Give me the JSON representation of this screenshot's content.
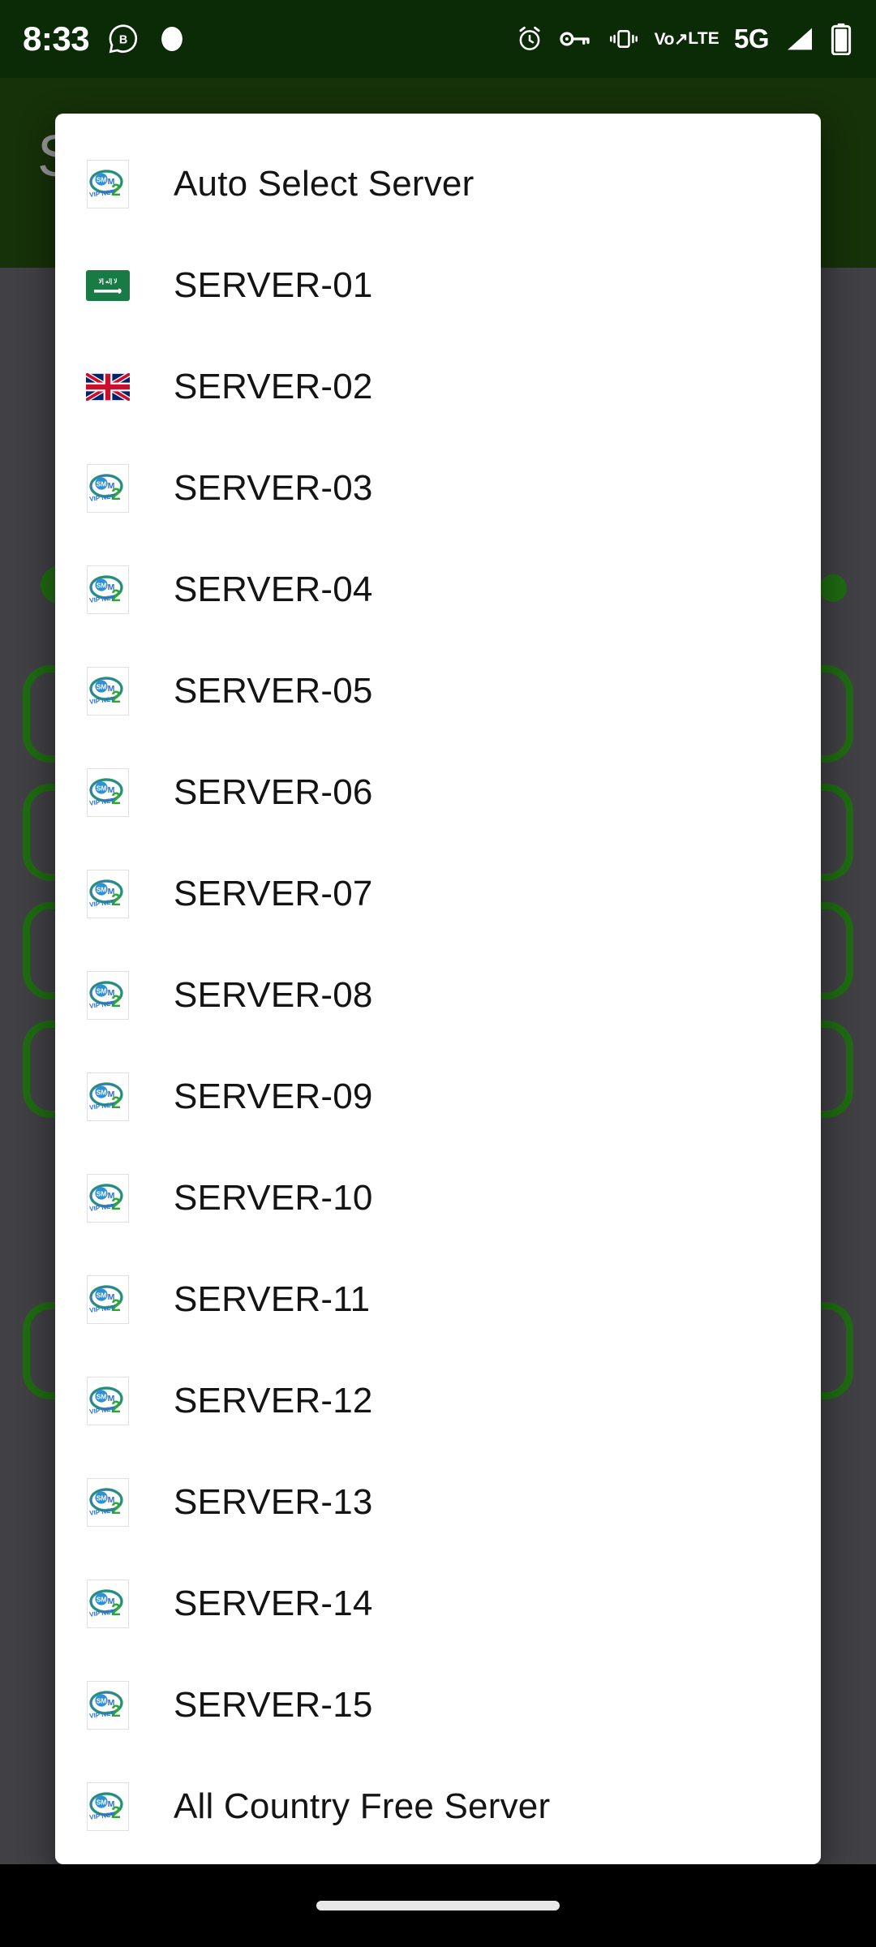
{
  "statusbar": {
    "clock": "8:33",
    "left_icons": [
      {
        "name": "whatsapp-business-icon",
        "glyph": "B"
      },
      {
        "name": "notification-dot-icon",
        "glyph": "●"
      }
    ],
    "right_icons": [
      {
        "name": "alarm-icon",
        "label": "alarm"
      },
      {
        "name": "vpn-key-icon",
        "label": "vpn key"
      },
      {
        "name": "vibrate-icon",
        "label": "vibrate"
      },
      {
        "name": "volte-icon",
        "line1": "Vo",
        "line2": "LTE"
      },
      {
        "name": "network-5g-icon",
        "label": "5G"
      },
      {
        "name": "signal-bars-icon",
        "label": "signal"
      },
      {
        "name": "battery-icon",
        "label": "battery"
      }
    ]
  },
  "background": {
    "appbar_title": "S",
    "accent_green": "#1f6b12",
    "appbar_color": "#163209",
    "scrim_color": "rgba(30,30,34,0.55)"
  },
  "dialog": {
    "name": "server-select-dialog",
    "background": "#ffffff",
    "items": [
      {
        "label": "Auto Select Server",
        "icon": "sm-vip-net-logo-icon"
      },
      {
        "label": "SERVER-01",
        "icon": "saudi-arabia-flag-icon"
      },
      {
        "label": "SERVER-02",
        "icon": "united-kingdom-flag-icon"
      },
      {
        "label": "SERVER-03",
        "icon": "sm-vip-net-logo-icon"
      },
      {
        "label": "SERVER-04",
        "icon": "sm-vip-net-logo-icon"
      },
      {
        "label": "SERVER-05",
        "icon": "sm-vip-net-logo-icon"
      },
      {
        "label": "SERVER-06",
        "icon": "sm-vip-net-logo-icon"
      },
      {
        "label": "SERVER-07",
        "icon": "sm-vip-net-logo-icon"
      },
      {
        "label": "SERVER-08",
        "icon": "sm-vip-net-logo-icon"
      },
      {
        "label": "SERVER-09",
        "icon": "sm-vip-net-logo-icon"
      },
      {
        "label": "SERVER-10",
        "icon": "sm-vip-net-logo-icon"
      },
      {
        "label": "SERVER-11",
        "icon": "sm-vip-net-logo-icon"
      },
      {
        "label": "SERVER-12",
        "icon": "sm-vip-net-logo-icon"
      },
      {
        "label": "SERVER-13",
        "icon": "sm-vip-net-logo-icon"
      },
      {
        "label": "SERVER-14",
        "icon": "sm-vip-net-logo-icon"
      },
      {
        "label": "SERVER-15",
        "icon": "sm-vip-net-logo-icon"
      },
      {
        "label": "All Country Free Server",
        "icon": "sm-vip-net-logo-icon"
      }
    ]
  },
  "navbar": {
    "gesture_pill": "home-gesture-pill"
  }
}
